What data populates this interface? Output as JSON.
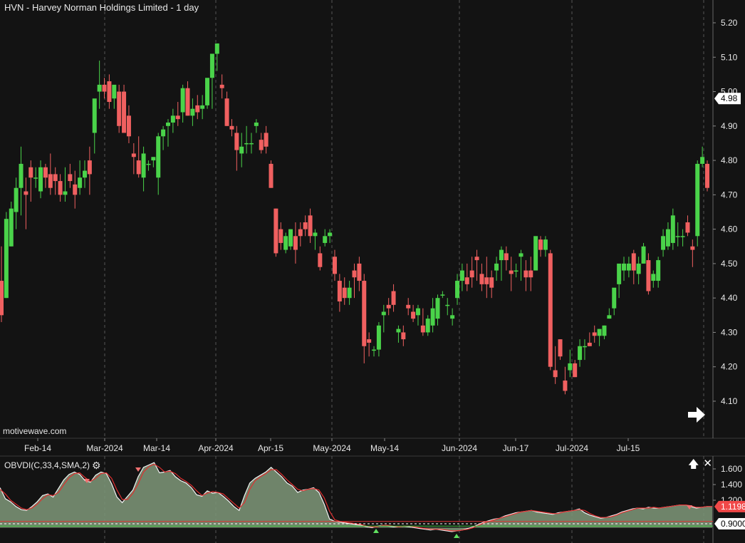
{
  "header": {
    "title": "HVN - Harvey Norman Holdings Limited - 1 day"
  },
  "watermark": "motivewave.com",
  "colors": {
    "background": "#131313",
    "up": "#4ad34a",
    "down": "#f06060",
    "grid": "#555555",
    "text": "#e8e8e8",
    "area": "#7a9174",
    "signal": "#e03030"
  },
  "icons": {
    "scroll_right": "right-arrow-icon",
    "settings": "gear-icon",
    "maximize": "up-arrow-icon",
    "close": "close-icon"
  },
  "chart_data": [
    {
      "type": "candlestick",
      "title": "HVN - Harvey Norman Holdings Limited - 1 day",
      "y_ticks": [
        "4.10",
        "4.20",
        "4.30",
        "4.40",
        "4.50",
        "4.60",
        "4.70",
        "4.80",
        "4.90",
        "5.00",
        "5.10",
        "5.20"
      ],
      "ylim": [
        4.0,
        5.25
      ],
      "x_ticks": [
        "Feb-14",
        "Mar-2024",
        "Mar-14",
        "Apr-2024",
        "Apr-15",
        "May-2024",
        "May-14",
        "Jun-2024",
        "Jun-17",
        "Jul-2024",
        "Jul-15"
      ],
      "last_price": "4.98",
      "candles": [
        [
          4.45,
          4.55,
          4.33,
          4.35
        ],
        [
          4.4,
          4.65,
          4.4,
          4.63
        ],
        [
          4.55,
          4.68,
          4.55,
          4.66
        ],
        [
          4.65,
          4.75,
          4.6,
          4.72
        ],
        [
          4.72,
          4.84,
          4.64,
          4.79
        ],
        [
          4.71,
          4.75,
          4.6,
          4.7
        ],
        [
          4.78,
          4.8,
          4.68,
          4.75
        ],
        [
          4.75,
          4.78,
          4.72,
          4.75
        ],
        [
          4.71,
          4.8,
          4.69,
          4.78
        ],
        [
          4.78,
          4.79,
          4.72,
          4.75
        ],
        [
          4.76,
          4.82,
          4.7,
          4.72
        ],
        [
          4.76,
          4.78,
          4.7,
          4.74
        ],
        [
          4.74,
          4.76,
          4.68,
          4.7
        ],
        [
          4.7,
          4.78,
          4.68,
          4.71
        ],
        [
          4.76,
          4.79,
          4.72,
          4.74
        ],
        [
          4.73,
          4.77,
          4.66,
          4.7
        ],
        [
          4.72,
          4.8,
          4.7,
          4.75
        ],
        [
          4.75,
          4.8,
          4.72,
          4.77
        ],
        [
          4.8,
          4.84,
          4.7,
          4.76
        ],
        [
          4.88,
          4.95,
          4.82,
          4.98
        ],
        [
          5.0,
          5.09,
          4.95,
          5.02
        ],
        [
          5.02,
          5.04,
          4.98,
          5.0
        ],
        [
          5.03,
          5.05,
          4.95,
          4.97
        ],
        [
          4.98,
          5.0,
          4.95,
          5.02
        ],
        [
          5.0,
          5.02,
          4.88,
          4.9
        ],
        [
          5.0,
          5.02,
          4.88,
          4.88
        ],
        [
          4.93,
          4.96,
          4.85,
          4.87
        ],
        [
          4.82,
          4.85,
          4.76,
          4.81
        ],
        [
          4.8,
          4.87,
          4.75,
          4.76
        ],
        [
          4.75,
          4.84,
          4.71,
          4.82
        ],
        [
          4.79,
          4.8,
          4.77,
          4.79
        ],
        [
          4.8,
          4.81,
          4.78,
          4.81
        ],
        [
          4.75,
          4.88,
          4.7,
          4.87
        ],
        [
          4.87,
          4.9,
          4.83,
          4.89
        ],
        [
          4.9,
          4.92,
          4.84,
          4.91
        ],
        [
          4.91,
          4.95,
          4.88,
          4.93
        ],
        [
          4.93,
          4.97,
          4.9,
          4.92
        ],
        [
          4.94,
          5.02,
          4.91,
          5.01
        ],
        [
          5.01,
          5.03,
          4.93,
          4.93
        ],
        [
          4.93,
          4.98,
          4.9,
          4.95
        ],
        [
          4.96,
          4.99,
          4.92,
          4.94
        ],
        [
          4.95,
          4.99,
          4.92,
          4.96
        ],
        [
          4.96,
          5.02,
          4.95,
          5.04
        ],
        [
          5.04,
          5.1,
          4.95,
          5.11
        ],
        [
          5.11,
          5.13,
          5.06,
          5.14
        ],
        [
          5.02,
          5.05,
          4.98,
          5.01
        ],
        [
          4.98,
          5.0,
          4.9,
          4.9
        ],
        [
          4.9,
          4.92,
          4.87,
          4.89
        ],
        [
          4.88,
          4.9,
          4.77,
          4.83
        ],
        [
          4.82,
          4.88,
          4.78,
          4.84
        ],
        [
          4.85,
          4.9,
          4.82,
          4.85
        ],
        [
          4.85,
          4.88,
          4.82,
          4.85
        ],
        [
          4.9,
          4.92,
          4.88,
          4.91
        ],
        [
          4.86,
          4.88,
          4.82,
          4.83
        ],
        [
          4.88,
          4.9,
          4.82,
          4.84
        ],
        [
          4.79,
          4.8,
          4.72,
          4.72
        ],
        [
          4.66,
          4.66,
          4.52,
          4.53
        ],
        [
          4.6,
          4.62,
          4.54,
          4.56
        ],
        [
          4.54,
          4.59,
          4.53,
          4.58
        ],
        [
          4.55,
          4.6,
          4.54,
          4.6
        ],
        [
          4.58,
          4.62,
          4.5,
          4.54
        ],
        [
          4.6,
          4.62,
          4.55,
          4.58
        ],
        [
          4.62,
          4.64,
          4.58,
          4.6
        ],
        [
          4.64,
          4.66,
          4.56,
          4.58
        ],
        [
          4.58,
          4.6,
          4.54,
          4.59
        ],
        [
          4.53,
          4.55,
          4.48,
          4.49
        ],
        [
          4.56,
          4.6,
          4.55,
          4.58
        ],
        [
          4.58,
          4.6,
          4.56,
          4.59
        ],
        [
          4.52,
          4.54,
          4.45,
          4.47
        ],
        [
          4.45,
          4.47,
          4.36,
          4.39
        ],
        [
          4.43,
          4.46,
          4.38,
          4.4
        ],
        [
          4.4,
          4.45,
          4.38,
          4.43
        ],
        [
          4.48,
          4.5,
          4.4,
          4.46
        ],
        [
          4.5,
          4.52,
          4.42,
          4.45
        ],
        [
          4.45,
          4.47,
          4.21,
          4.26
        ],
        [
          4.28,
          4.3,
          4.23,
          4.27
        ],
        [
          4.25,
          4.26,
          4.23,
          4.25
        ],
        [
          4.25,
          4.33,
          4.23,
          4.32
        ],
        [
          4.35,
          4.38,
          4.3,
          4.36
        ],
        [
          4.38,
          4.4,
          4.35,
          4.37
        ],
        [
          4.42,
          4.44,
          4.36,
          4.38
        ],
        [
          4.3,
          4.32,
          4.27,
          4.31
        ],
        [
          4.3,
          4.32,
          4.26,
          4.28
        ],
        [
          4.38,
          4.4,
          4.35,
          4.37
        ],
        [
          4.36,
          4.38,
          4.33,
          4.34
        ],
        [
          4.35,
          4.38,
          4.32,
          4.37
        ],
        [
          4.32,
          4.37,
          4.29,
          4.3
        ],
        [
          4.3,
          4.35,
          4.29,
          4.34
        ],
        [
          4.32,
          4.4,
          4.3,
          4.37
        ],
        [
          4.34,
          4.41,
          4.32,
          4.4
        ],
        [
          4.41,
          4.42,
          4.4,
          4.41
        ],
        [
          4.38,
          4.4,
          4.35,
          4.38
        ],
        [
          4.34,
          4.37,
          4.32,
          4.35
        ],
        [
          4.4,
          4.47,
          4.38,
          4.45
        ],
        [
          4.45,
          4.5,
          4.42,
          4.48
        ],
        [
          4.46,
          4.5,
          4.42,
          4.44
        ],
        [
          4.48,
          4.52,
          4.43,
          4.46
        ],
        [
          4.52,
          4.54,
          4.45,
          4.51
        ],
        [
          4.47,
          4.5,
          4.42,
          4.44
        ],
        [
          4.46,
          4.52,
          4.4,
          4.44
        ],
        [
          4.46,
          4.48,
          4.4,
          4.43
        ],
        [
          4.48,
          4.52,
          4.45,
          4.5
        ],
        [
          4.51,
          4.55,
          4.45,
          4.54
        ],
        [
          4.53,
          4.55,
          4.48,
          4.51
        ],
        [
          4.48,
          4.52,
          4.42,
          4.47
        ],
        [
          4.48,
          4.5,
          4.46,
          4.48
        ],
        [
          4.52,
          4.54,
          4.45,
          4.53
        ],
        [
          4.48,
          4.51,
          4.42,
          4.46
        ],
        [
          4.48,
          4.52,
          4.42,
          4.46
        ],
        [
          4.48,
          4.57,
          4.48,
          4.58
        ],
        [
          4.57,
          4.58,
          4.52,
          4.54
        ],
        [
          4.54,
          4.58,
          4.52,
          4.57
        ],
        [
          4.53,
          4.54,
          4.19,
          4.2
        ],
        [
          4.19,
          4.26,
          4.15,
          4.17
        ],
        [
          4.28,
          4.28,
          4.22,
          4.23
        ],
        [
          4.16,
          4.2,
          4.12,
          4.13
        ],
        [
          4.19,
          4.25,
          4.17,
          4.21
        ],
        [
          4.21,
          4.22,
          4.17,
          4.17
        ],
        [
          4.22,
          4.28,
          4.2,
          4.26
        ],
        [
          4.26,
          4.28,
          4.22,
          4.26
        ],
        [
          4.27,
          4.3,
          4.26,
          4.26
        ],
        [
          4.3,
          4.32,
          4.27,
          4.29
        ],
        [
          4.29,
          4.31,
          4.26,
          4.31
        ],
        [
          4.29,
          4.32,
          4.28,
          4.32
        ],
        [
          4.34,
          4.37,
          4.34,
          4.35
        ],
        [
          4.37,
          4.41,
          4.35,
          4.43
        ],
        [
          4.44,
          4.48,
          4.4,
          4.5
        ],
        [
          4.48,
          4.52,
          4.45,
          4.5
        ],
        [
          4.48,
          4.52,
          4.46,
          4.5
        ],
        [
          4.53,
          4.54,
          4.44,
          4.48
        ],
        [
          4.47,
          4.52,
          4.44,
          4.5
        ],
        [
          4.5,
          4.56,
          4.5,
          4.55
        ],
        [
          4.51,
          4.53,
          4.41,
          4.42
        ],
        [
          4.45,
          4.48,
          4.43,
          4.47
        ],
        [
          4.45,
          4.52,
          4.43,
          4.51
        ],
        [
          4.54,
          4.6,
          4.52,
          4.58
        ],
        [
          4.55,
          4.62,
          4.54,
          4.6
        ],
        [
          4.56,
          4.66,
          4.54,
          4.64
        ],
        [
          4.58,
          4.62,
          4.55,
          4.58
        ],
        [
          4.58,
          4.6,
          4.55,
          4.58
        ],
        [
          4.62,
          4.64,
          4.58,
          4.59
        ],
        [
          4.55,
          4.57,
          4.49,
          4.54
        ],
        [
          4.58,
          4.8,
          4.55,
          4.79
        ],
        [
          4.79,
          4.84,
          4.78,
          4.81
        ],
        [
          4.79,
          4.8,
          4.71,
          4.72
        ]
      ]
    },
    {
      "type": "area",
      "title": "OBVDI(C,33,4,SMA,2)",
      "y_ticks": [
        "1.600",
        "1.400",
        "1.200"
      ],
      "ylim": [
        0.85,
        1.7
      ],
      "markers": {
        "current": "1.1198",
        "signal": "0.9000"
      },
      "series": [
        {
          "values": [
            1.36,
            1.22,
            1.18,
            1.12,
            1.08,
            1.07,
            1.12,
            1.18,
            1.26,
            1.28,
            1.24,
            1.35,
            1.46,
            1.53,
            1.56,
            1.53,
            1.45,
            1.43,
            1.52,
            1.56,
            1.54,
            1.41,
            1.24,
            1.17,
            1.25,
            1.33,
            1.5,
            1.62,
            1.65,
            1.68,
            1.55,
            1.56,
            1.58,
            1.5,
            1.45,
            1.42,
            1.36,
            1.27,
            1.25,
            1.32,
            1.29,
            1.3,
            1.25,
            1.19,
            1.12,
            1.07,
            1.26,
            1.42,
            1.48,
            1.52,
            1.56,
            1.62,
            1.56,
            1.5,
            1.42,
            1.38,
            1.3,
            1.33,
            1.34,
            1.36,
            1.3,
            1.15,
            0.96,
            0.93,
            0.92,
            0.91,
            0.9,
            0.89,
            0.88,
            0.86,
            0.85,
            0.87,
            0.88,
            0.87,
            0.86,
            0.86,
            0.87,
            0.86,
            0.85,
            0.84,
            0.83,
            0.82,
            0.83,
            0.82,
            0.81,
            0.8,
            0.81,
            0.82,
            0.84,
            0.86,
            0.89,
            0.92,
            0.94,
            0.96,
            0.97,
            1.0,
            1.02,
            1.04,
            1.05,
            1.06,
            1.07,
            1.05,
            1.04,
            1.03,
            1.02,
            1.04,
            1.05,
            1.06,
            1.07,
            1.09,
            1.04,
            1.01,
            0.99,
            0.97,
            0.98,
            1.0,
            1.02,
            1.05,
            1.07,
            1.09,
            1.1,
            1.09,
            1.11,
            1.1,
            1.1,
            1.11,
            1.12,
            1.13,
            1.14,
            1.14,
            1.12,
            1.1,
            1.11,
            1.12,
            1.12
          ]
        },
        {
          "values": [
            1.34,
            1.28,
            1.2,
            1.15,
            1.1,
            1.08,
            1.1,
            1.15,
            1.22,
            1.27,
            1.26,
            1.3,
            1.4,
            1.49,
            1.54,
            1.55,
            1.49,
            1.44,
            1.48,
            1.54,
            1.55,
            1.48,
            1.33,
            1.21,
            1.21,
            1.29,
            1.41,
            1.56,
            1.63,
            1.66,
            1.62,
            1.56,
            1.57,
            1.54,
            1.48,
            1.44,
            1.39,
            1.32,
            1.26,
            1.29,
            1.31,
            1.3,
            1.28,
            1.22,
            1.16,
            1.1,
            1.17,
            1.34,
            1.45,
            1.5,
            1.54,
            1.59,
            1.59,
            1.53,
            1.46,
            1.4,
            1.34,
            1.32,
            1.34,
            1.35,
            1.33,
            1.23,
            1.06,
            0.95,
            0.93,
            0.92,
            0.91,
            0.9,
            0.89,
            0.87,
            0.86,
            0.86,
            0.88,
            0.88,
            0.87,
            0.86,
            0.87,
            0.87,
            0.86,
            0.85,
            0.84,
            0.83,
            0.83,
            0.83,
            0.82,
            0.81,
            0.81,
            0.82,
            0.83,
            0.85,
            0.88,
            0.91,
            0.93,
            0.95,
            0.97,
            0.99,
            1.01,
            1.03,
            1.05,
            1.06,
            1.07,
            1.06,
            1.05,
            1.04,
            1.03,
            1.03,
            1.05,
            1.06,
            1.07,
            1.08,
            1.07,
            1.03,
            1.0,
            0.98,
            0.98,
            0.99,
            1.01,
            1.04,
            1.06,
            1.08,
            1.1,
            1.1,
            1.1,
            1.11,
            1.1,
            1.11,
            1.12,
            1.13,
            1.14,
            1.14,
            1.13,
            1.11,
            1.11,
            1.12,
            1.12
          ]
        }
      ]
    }
  ]
}
